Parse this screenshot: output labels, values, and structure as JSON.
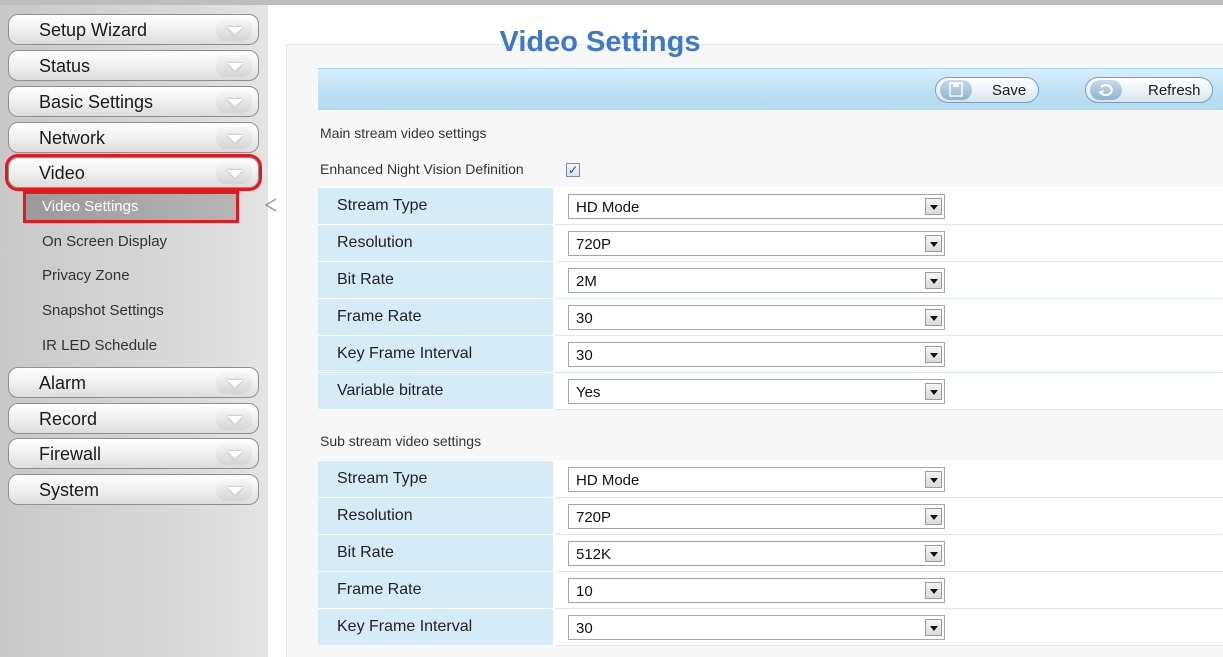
{
  "sidebar": {
    "menu": [
      {
        "label": "Setup Wizard",
        "icon": "chevron-down-icon"
      },
      {
        "label": "Status",
        "icon": "chevron-down-icon"
      },
      {
        "label": "Basic Settings",
        "icon": "chevron-down-icon"
      },
      {
        "label": "Network",
        "icon": "chevron-down-icon"
      },
      {
        "label": "Video",
        "icon": "chevron-down-icon"
      },
      {
        "label": "Alarm",
        "icon": "chevron-down-icon"
      },
      {
        "label": "Record",
        "icon": "chevron-down-icon"
      },
      {
        "label": "Firewall",
        "icon": "chevron-down-icon"
      },
      {
        "label": "System",
        "icon": "chevron-down-icon"
      }
    ],
    "video_submenu": [
      {
        "label": "Video Settings",
        "active": true
      },
      {
        "label": "On Screen Display"
      },
      {
        "label": "Privacy Zone"
      },
      {
        "label": "Snapshot Settings"
      },
      {
        "label": "IR LED Schedule"
      }
    ],
    "highlight_color": "#e8171b"
  },
  "main": {
    "title": "Video Settings",
    "toolbar": {
      "save_label": "Save",
      "refresh_label": "Refresh",
      "save_icon": "floppy-disk-icon",
      "refresh_icon": "refresh-arrow-icon"
    },
    "main_stream_label": "Main stream video settings",
    "night_vision_label": "Enhanced Night Vision Definition",
    "night_vision_checked": true,
    "main_stream": [
      {
        "label": "Stream Type",
        "value": "HD Mode"
      },
      {
        "label": "Resolution",
        "value": "720P"
      },
      {
        "label": "Bit Rate",
        "value": "2M"
      },
      {
        "label": "Frame Rate",
        "value": "30"
      },
      {
        "label": "Key Frame Interval",
        "value": "30"
      },
      {
        "label": "Variable bitrate",
        "value": "Yes"
      }
    ],
    "sub_stream_label": "Sub stream video settings",
    "sub_stream": [
      {
        "label": "Stream Type",
        "value": "HD Mode"
      },
      {
        "label": "Resolution",
        "value": "720P"
      },
      {
        "label": "Bit Rate",
        "value": "512K"
      },
      {
        "label": "Frame Rate",
        "value": "10"
      },
      {
        "label": "Key Frame Interval",
        "value": "30"
      }
    ],
    "accent_color": "#3d78c9"
  }
}
